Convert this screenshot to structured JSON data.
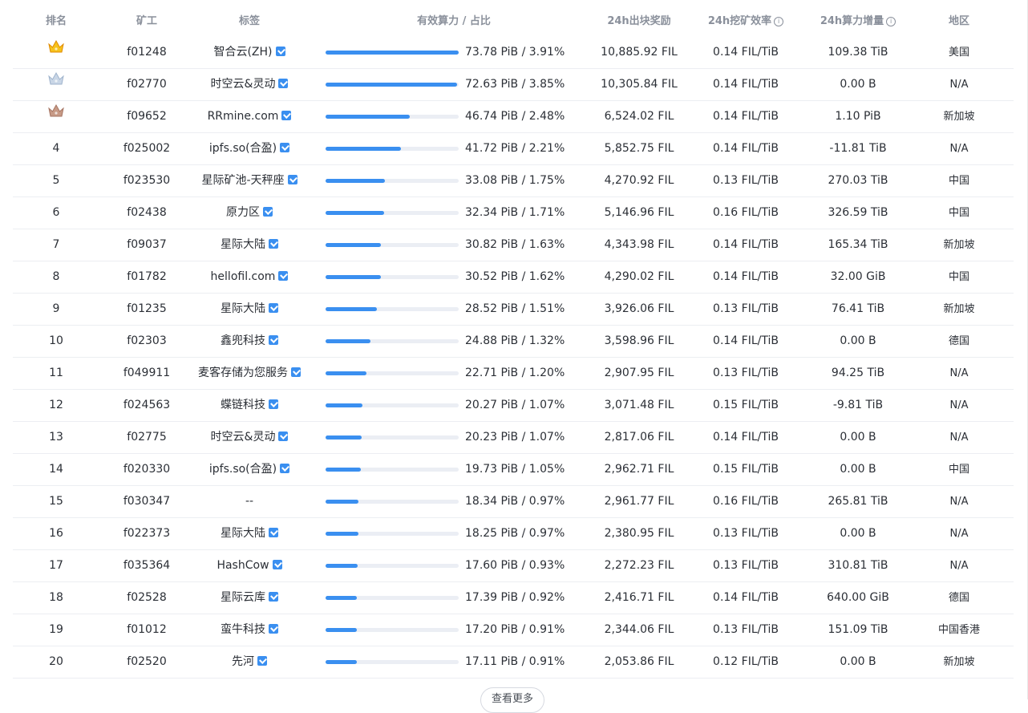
{
  "table": {
    "headers": {
      "rank": "排名",
      "miner": "矿工",
      "tag": "标签",
      "power": "有效算力 / 占比",
      "reward": "24h出块奖励",
      "efficiency": "24h挖矿效率",
      "increase": "24h算力增量",
      "region": "地区"
    },
    "rows": [
      {
        "rank": "1",
        "medal": "gold",
        "miner": "f01248",
        "tag": "智合云(ZH)",
        "verified": true,
        "power": "73.78 PiB / 3.91%",
        "share": 1.0,
        "reward": "10,885.92 FIL",
        "efficiency": "0.14 FIL/TiB",
        "increase": "109.38 TiB",
        "region": "美国"
      },
      {
        "rank": "2",
        "medal": "silver",
        "miner": "f02770",
        "tag": "时空云&灵动",
        "verified": true,
        "power": "72.63 PiB / 3.85%",
        "share": 0.985,
        "reward": "10,305.84 FIL",
        "efficiency": "0.14 FIL/TiB",
        "increase": "0.00 B",
        "region": "N/A"
      },
      {
        "rank": "3",
        "medal": "bronze",
        "miner": "f09652",
        "tag": "RRmine.com",
        "verified": true,
        "power": "46.74 PiB / 2.48%",
        "share": 0.634,
        "reward": "6,524.02 FIL",
        "efficiency": "0.14 FIL/TiB",
        "increase": "1.10 PiB",
        "region": "新加坡"
      },
      {
        "rank": "4",
        "medal": "",
        "miner": "f025002",
        "tag": "ipfs.so(合盈)",
        "verified": true,
        "power": "41.72 PiB / 2.21%",
        "share": 0.565,
        "reward": "5,852.75 FIL",
        "efficiency": "0.14 FIL/TiB",
        "increase": "-11.81 TiB",
        "region": "N/A"
      },
      {
        "rank": "5",
        "medal": "",
        "miner": "f023530",
        "tag": "星际矿池-天秤座",
        "verified": true,
        "power": "33.08 PiB / 1.75%",
        "share": 0.448,
        "reward": "4,270.92 FIL",
        "efficiency": "0.13 FIL/TiB",
        "increase": "270.03 TiB",
        "region": "中国"
      },
      {
        "rank": "6",
        "medal": "",
        "miner": "f02438",
        "tag": "原力区",
        "verified": true,
        "power": "32.34 PiB / 1.71%",
        "share": 0.438,
        "reward": "5,146.96 FIL",
        "efficiency": "0.16 FIL/TiB",
        "increase": "326.59 TiB",
        "region": "中国"
      },
      {
        "rank": "7",
        "medal": "",
        "miner": "f09037",
        "tag": "星际大陆",
        "verified": true,
        "power": "30.82 PiB / 1.63%",
        "share": 0.418,
        "reward": "4,343.98 FIL",
        "efficiency": "0.14 FIL/TiB",
        "increase": "165.34 TiB",
        "region": "新加坡"
      },
      {
        "rank": "8",
        "medal": "",
        "miner": "f01782",
        "tag": "hellofil.com",
        "verified": true,
        "power": "30.52 PiB / 1.62%",
        "share": 0.414,
        "reward": "4,290.02 FIL",
        "efficiency": "0.14 FIL/TiB",
        "increase": "32.00 GiB",
        "region": "中国"
      },
      {
        "rank": "9",
        "medal": "",
        "miner": "f01235",
        "tag": "星际大陆",
        "verified": true,
        "power": "28.52 PiB / 1.51%",
        "share": 0.387,
        "reward": "3,926.06 FIL",
        "efficiency": "0.13 FIL/TiB",
        "increase": "76.41 TiB",
        "region": "新加坡"
      },
      {
        "rank": "10",
        "medal": "",
        "miner": "f02303",
        "tag": "鑫兜科技",
        "verified": true,
        "power": "24.88 PiB / 1.32%",
        "share": 0.337,
        "reward": "3,598.96 FIL",
        "efficiency": "0.14 FIL/TiB",
        "increase": "0.00 B",
        "region": "德国"
      },
      {
        "rank": "11",
        "medal": "",
        "miner": "f049911",
        "tag": "麦客存储为您服务",
        "verified": true,
        "power": "22.71 PiB / 1.20%",
        "share": 0.308,
        "reward": "2,907.95 FIL",
        "efficiency": "0.13 FIL/TiB",
        "increase": "94.25 TiB",
        "region": "N/A"
      },
      {
        "rank": "12",
        "medal": "",
        "miner": "f024563",
        "tag": "蝶链科技",
        "verified": true,
        "power": "20.27 PiB / 1.07%",
        "share": 0.275,
        "reward": "3,071.48 FIL",
        "efficiency": "0.15 FIL/TiB",
        "increase": "-9.81 TiB",
        "region": "N/A"
      },
      {
        "rank": "13",
        "medal": "",
        "miner": "f02775",
        "tag": "时空云&灵动",
        "verified": true,
        "power": "20.23 PiB / 1.07%",
        "share": 0.274,
        "reward": "2,817.06 FIL",
        "efficiency": "0.14 FIL/TiB",
        "increase": "0.00 B",
        "region": "N/A"
      },
      {
        "rank": "14",
        "medal": "",
        "miner": "f020330",
        "tag": "ipfs.so(合盈)",
        "verified": true,
        "power": "19.73 PiB / 1.05%",
        "share": 0.267,
        "reward": "2,962.71 FIL",
        "efficiency": "0.15 FIL/TiB",
        "increase": "0.00 B",
        "region": "中国"
      },
      {
        "rank": "15",
        "medal": "",
        "miner": "f030347",
        "tag": "--",
        "verified": false,
        "power": "18.34 PiB / 0.97%",
        "share": 0.249,
        "reward": "2,961.77 FIL",
        "efficiency": "0.16 FIL/TiB",
        "increase": "265.81 TiB",
        "region": "N/A"
      },
      {
        "rank": "16",
        "medal": "",
        "miner": "f022373",
        "tag": "星际大陆",
        "verified": true,
        "power": "18.25 PiB / 0.97%",
        "share": 0.247,
        "reward": "2,380.95 FIL",
        "efficiency": "0.13 FIL/TiB",
        "increase": "0.00 B",
        "region": "N/A"
      },
      {
        "rank": "17",
        "medal": "",
        "miner": "f035364",
        "tag": "HashCow",
        "verified": true,
        "power": "17.60 PiB / 0.93%",
        "share": 0.239,
        "reward": "2,272.23 FIL",
        "efficiency": "0.13 FIL/TiB",
        "increase": "310.81 TiB",
        "region": "N/A"
      },
      {
        "rank": "18",
        "medal": "",
        "miner": "f02528",
        "tag": "星际云库",
        "verified": true,
        "power": "17.39 PiB / 0.92%",
        "share": 0.236,
        "reward": "2,416.71 FIL",
        "efficiency": "0.14 FIL/TiB",
        "increase": "640.00 GiB",
        "region": "德国"
      },
      {
        "rank": "19",
        "medal": "",
        "miner": "f01012",
        "tag": "蛮牛科技",
        "verified": true,
        "power": "17.20 PiB / 0.91%",
        "share": 0.233,
        "reward": "2,344.06 FIL",
        "efficiency": "0.13 FIL/TiB",
        "increase": "151.09 TiB",
        "region": "中国香港"
      },
      {
        "rank": "20",
        "medal": "",
        "miner": "f02520",
        "tag": "先河",
        "verified": true,
        "power": "17.11 PiB / 0.91%",
        "share": 0.232,
        "reward": "2,053.86 FIL",
        "efficiency": "0.12 FIL/TiB",
        "increase": "0.00 B",
        "region": "新加坡"
      }
    ]
  },
  "more_button": "查看更多",
  "colors": {
    "accent": "#3a8ff0",
    "track": "#ebeef4",
    "header_text": "#8a909b",
    "gold": "#f6c21c",
    "silver": "#c9d6e6",
    "bronze": "#c79a86"
  }
}
